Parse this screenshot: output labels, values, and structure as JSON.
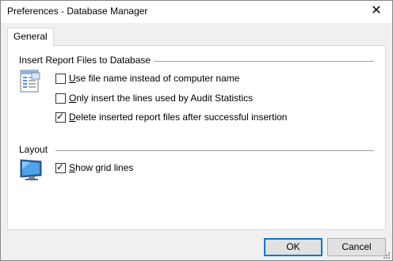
{
  "window": {
    "title": "Preferences - Database Manager"
  },
  "tabs": [
    {
      "label": "General",
      "active": true
    }
  ],
  "groups": {
    "insert": {
      "title": "Insert Report Files to Database",
      "options": [
        {
          "mnemonic": "U",
          "rest": "se file name instead of computer name",
          "checked": false
        },
        {
          "mnemonic": "O",
          "rest": "nly insert the lines used by Audit Statistics",
          "checked": false
        },
        {
          "mnemonic": "D",
          "rest": "elete inserted report files after successful insertion",
          "checked": true
        }
      ]
    },
    "layout": {
      "title": "Layout",
      "options": [
        {
          "mnemonic": "S",
          "rest": "how grid lines",
          "checked": true
        }
      ]
    }
  },
  "buttons": {
    "ok": "OK",
    "cancel": "Cancel"
  },
  "icons": {
    "close": "close-icon",
    "insert_group": "document-table-icon",
    "layout_group": "monitor-icon"
  }
}
